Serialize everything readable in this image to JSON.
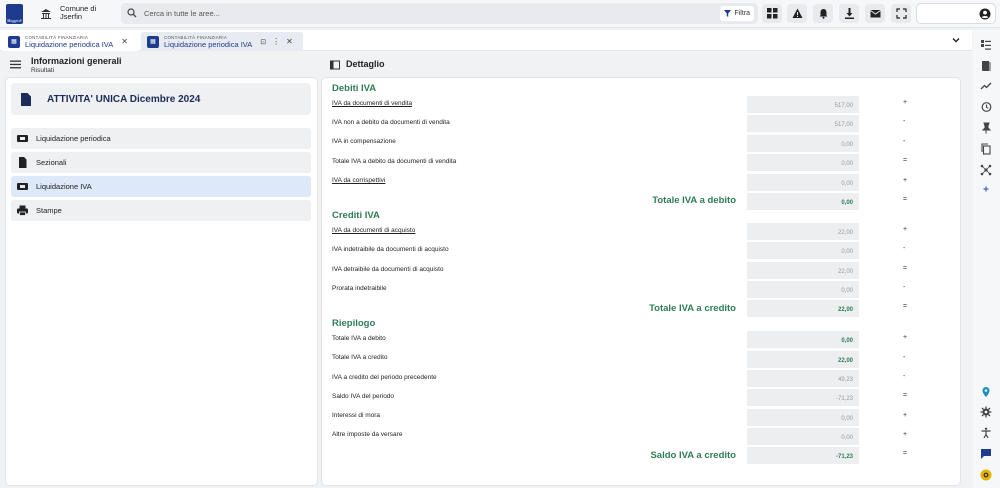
{
  "header": {
    "logo_text": "Maggioli",
    "municipality_line1": "Comune di",
    "municipality_line2": "Jserfin",
    "search_placeholder": "Cerca in tutte le aree...",
    "filter_label": "Filtra"
  },
  "tabs": [
    {
      "category": "CONTABILITÀ FINANZIARIA",
      "title": "Liquidazione periodica IVA"
    },
    {
      "category": "CONTABILITÀ FINANZIARIA",
      "title": "Liquidazione periodica IVA"
    }
  ],
  "left": {
    "title": "Informazioni generali",
    "subtitle": "Risultati",
    "card_title": "ATTIVITA' UNICA Dicembre 2024",
    "nav": [
      {
        "label": "Liquidazione periodica"
      },
      {
        "label": "Sezionali"
      },
      {
        "label": "Liquidazione IVA"
      },
      {
        "label": "Stampe"
      }
    ]
  },
  "detail": {
    "title": "Dettaglio",
    "debiti": {
      "title": "Debiti IVA",
      "rows": [
        {
          "label": "IVA da documenti di vendita",
          "value": "517,00",
          "op": "+"
        },
        {
          "label": "IVA non a debito da documenti di vendita",
          "value": "517,00",
          "op": "-"
        },
        {
          "label": "IVA in compensazione",
          "value": "0,00",
          "op": "-"
        },
        {
          "label": "Totale IVA a debito da documenti di vendita",
          "value": "0,00",
          "op": "="
        },
        {
          "label": "IVA da corrispettivi",
          "value": "0,00",
          "op": "+"
        }
      ],
      "total_label": "Totale IVA a debito",
      "total_value": "0,00",
      "total_op": "="
    },
    "crediti": {
      "title": "Crediti IVA",
      "rows": [
        {
          "label": "IVA da documenti di acquisto",
          "value": "22,00",
          "op": "+"
        },
        {
          "label": "IVA indetraibile da documenti di acquisto",
          "value": "0,00",
          "op": "-"
        },
        {
          "label": "IVA detraibile da documenti di acquisto",
          "value": "22,00",
          "op": "="
        },
        {
          "label": "Prorata indetraibile",
          "value": "0,00",
          "op": "-"
        }
      ],
      "total_label": "Totale IVA a credito",
      "total_value": "22,00",
      "total_op": "="
    },
    "riepilogo": {
      "title": "Riepilogo",
      "rows": [
        {
          "label": "Totale IVA a debito",
          "value": "0,00",
          "op": "+"
        },
        {
          "label": "Totale IVA a credito",
          "value": "22,00",
          "op": "-"
        },
        {
          "label": "IVA a credito del periodo precedente",
          "value": "49,23",
          "op": "-"
        },
        {
          "label": "Saldo IVA del periodo",
          "value": "-71,23",
          "op": "="
        },
        {
          "label": "Interessi di mora",
          "value": "0,00",
          "op": "+"
        },
        {
          "label": "Altre imposte da versare",
          "value": "0,00",
          "op": "+"
        }
      ],
      "total_label": "Saldo IVA a credito",
      "total_value": "-71,23",
      "total_op": "="
    }
  }
}
